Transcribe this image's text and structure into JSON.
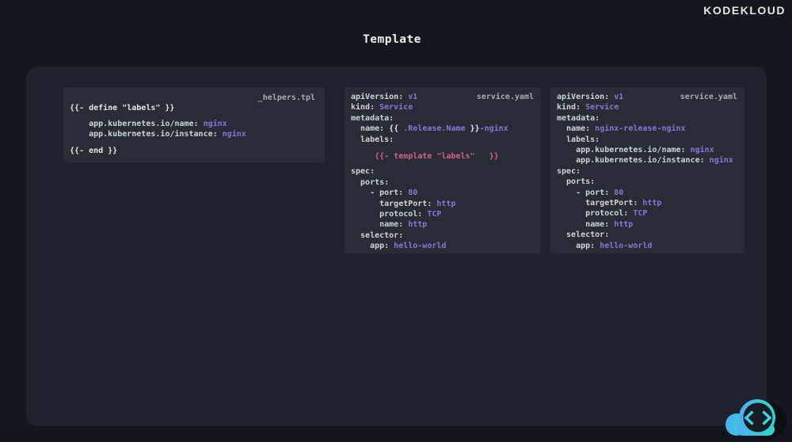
{
  "brand": {
    "logo": "KODEKLOUD"
  },
  "header": {
    "title": "Template"
  },
  "colors": {
    "background": "#14171e",
    "board": "#1d222c",
    "panel": "#272c37",
    "key": "#ccd5da",
    "plain": "#e0e6ea",
    "purple": "#8677d8",
    "pink": "#d4608c",
    "filename": "#a6adb5",
    "cloud_blue": "#4fadf0",
    "cloud_cyan": "#2ed8cd",
    "chevron_cyan": "#3bd7e3"
  },
  "footer": {
    "icon": "cloud-code-icon"
  },
  "panels": [
    {
      "filename": "_helpers.tpl",
      "lines": [
        {
          "segs": [
            [
              "w",
              "{{- define \"labels\" }}"
            ]
          ]
        },
        {
          "cls": "gap-sm",
          "segs": [
            [
              "k",
              "    app.kubernetes.io/name: "
            ],
            [
              "v",
              "nginx"
            ]
          ]
        },
        {
          "segs": [
            [
              "k",
              "    app.kubernetes.io/instance: "
            ],
            [
              "v",
              "nginx"
            ]
          ]
        },
        {
          "cls": "gap-md",
          "segs": [
            [
              "w",
              "{{- end }}"
            ]
          ]
        }
      ]
    },
    {
      "filename": "service.yaml",
      "lines": [
        {
          "segs": [
            [
              "k",
              "apiVersion: "
            ],
            [
              "v",
              "v1"
            ]
          ]
        },
        {
          "segs": [
            [
              "k",
              "kind: "
            ],
            [
              "v",
              "Service"
            ]
          ]
        },
        {
          "segs": [
            [
              "k",
              "metadata:"
            ]
          ]
        },
        {
          "segs": [
            [
              "k",
              "  name: "
            ],
            [
              "w",
              "{{ "
            ],
            [
              "v",
              ".Release.Name"
            ],
            [
              "w",
              " }}"
            ],
            [
              "v",
              "-nginx"
            ]
          ]
        },
        {
          "segs": [
            [
              "k",
              "  labels:"
            ]
          ]
        },
        {
          "cls": "tpl-gap",
          "segs": [
            [
              "p",
              "     {{- template \"labels\"   }}"
            ]
          ]
        },
        {
          "segs": [
            [
              "k",
              "spec:"
            ]
          ]
        },
        {
          "segs": [
            [
              "k",
              "  ports:"
            ]
          ]
        },
        {
          "segs": [
            [
              "k",
              "    - port: "
            ],
            [
              "v",
              "80"
            ]
          ]
        },
        {
          "segs": [
            [
              "k",
              "      targetPort: "
            ],
            [
              "v",
              "http"
            ]
          ]
        },
        {
          "segs": [
            [
              "k",
              "      protocol: "
            ],
            [
              "v",
              "TCP"
            ]
          ]
        },
        {
          "segs": [
            [
              "k",
              "      name: "
            ],
            [
              "v",
              "http"
            ]
          ]
        },
        {
          "segs": [
            [
              "k",
              "  selector:"
            ]
          ]
        },
        {
          "segs": [
            [
              "k",
              "    app: "
            ],
            [
              "v",
              "hello-world"
            ]
          ]
        }
      ]
    },
    {
      "filename": "service.yaml",
      "lines": [
        {
          "segs": [
            [
              "k",
              "apiVersion: "
            ],
            [
              "v",
              "v1"
            ]
          ]
        },
        {
          "segs": [
            [
              "k",
              "kind: "
            ],
            [
              "v",
              "Service"
            ]
          ]
        },
        {
          "segs": [
            [
              "k",
              "metadata:"
            ]
          ]
        },
        {
          "segs": [
            [
              "k",
              "  name: "
            ],
            [
              "v",
              "nginx-release-nginx"
            ]
          ]
        },
        {
          "segs": [
            [
              "k",
              "  labels:"
            ]
          ]
        },
        {
          "segs": [
            [
              "k",
              "    app.kubernetes.io/name: "
            ],
            [
              "v",
              "nginx"
            ]
          ]
        },
        {
          "segs": [
            [
              "k",
              "    app.kubernetes.io/instance: "
            ],
            [
              "v",
              "nginx"
            ]
          ]
        },
        {
          "segs": [
            [
              "k",
              "spec:"
            ]
          ]
        },
        {
          "segs": [
            [
              "k",
              "  ports:"
            ]
          ]
        },
        {
          "segs": [
            [
              "k",
              "    - port: "
            ],
            [
              "v",
              "80"
            ]
          ]
        },
        {
          "segs": [
            [
              "k",
              "      targetPort: "
            ],
            [
              "v",
              "http"
            ]
          ]
        },
        {
          "segs": [
            [
              "k",
              "      protocol: "
            ],
            [
              "v",
              "TCP"
            ]
          ]
        },
        {
          "segs": [
            [
              "k",
              "      name: "
            ],
            [
              "v",
              "http"
            ]
          ]
        },
        {
          "segs": [
            [
              "k",
              "  selector:"
            ]
          ]
        },
        {
          "segs": [
            [
              "k",
              "    app: "
            ],
            [
              "v",
              "hello-world"
            ]
          ]
        }
      ]
    }
  ]
}
